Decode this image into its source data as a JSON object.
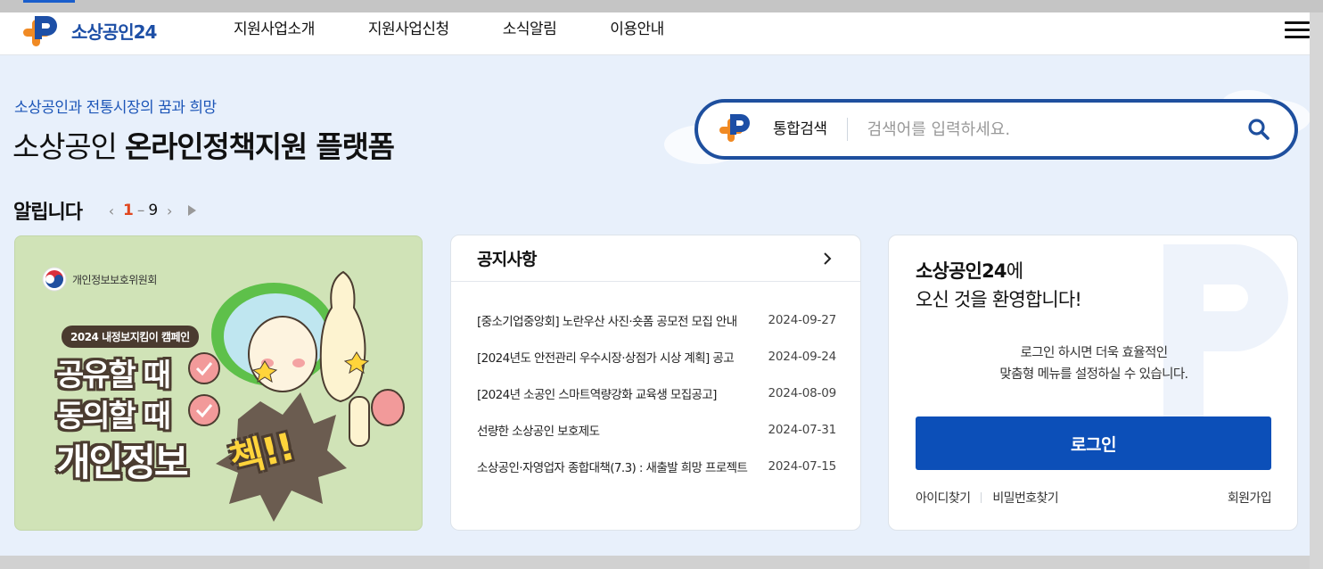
{
  "header": {
    "logo_text": "소상공인24",
    "nav": [
      "지원사업소개",
      "지원사업신청",
      "소식알림",
      "이용안내"
    ]
  },
  "hero": {
    "tagline": "소상공인과 전통시장의 꿈과 희망",
    "title_light": "소상공인 ",
    "title_bold": "온라인정책지원 플랫폼"
  },
  "search": {
    "label": "통합검색",
    "placeholder": "검색어를 입력하세요."
  },
  "notices_section": {
    "title": "알립니다",
    "current_page": "1",
    "separator": "–",
    "total_pages": "9"
  },
  "banner": {
    "org": "개인정보보호위원회",
    "campaign": "2024 내정보지킴이 캠페인",
    "line1": "공유할 때",
    "line2": "동의할 때",
    "line3": "개인정보",
    "check_word": "첵!!"
  },
  "notice_card": {
    "title": "공지사항",
    "items": [
      {
        "title": "[중소기업중앙회] 노란우산 사진·숏폼 공모전 모집 안내",
        "date": "2024-09-27"
      },
      {
        "title": "[2024년도 안전관리 우수시장·상점가 시상 계획] 공고",
        "date": "2024-09-24"
      },
      {
        "title": "[2024년 소공인 스마트역량강화 교육생 모집공고]",
        "date": "2024-08-09"
      },
      {
        "title": "선량한 소상공인 보호제도",
        "date": "2024-07-31"
      },
      {
        "title": "소상공인·자영업자 종합대책(7.3) : 새출발 희망 프로젝트",
        "date": "2024-07-15"
      }
    ]
  },
  "login_card": {
    "welcome_bold": "소상공인24",
    "welcome_rest": "에",
    "welcome_line2": "오신 것을 환영합니다!",
    "desc_line1": "로그인 하시면 더욱 효율적인",
    "desc_line2": "맞춤형 메뉴를 설정하실 수 있습니다.",
    "login_button": "로그인",
    "find_id": "아이디찾기",
    "find_pw": "비밀번호찾기",
    "join": "회원가입"
  },
  "colors": {
    "brand_blue": "#1d4fa6",
    "brand_orange": "#f08a24",
    "button_blue": "#0c4fb8",
    "page_bg": "#e8f0fb",
    "pager_current": "#e0471f"
  },
  "icons": [
    "logo-icon",
    "menu-icon",
    "search-icon",
    "chevron-right-icon",
    "prev-icon",
    "next-icon",
    "play-icon",
    "seal-icon"
  ]
}
